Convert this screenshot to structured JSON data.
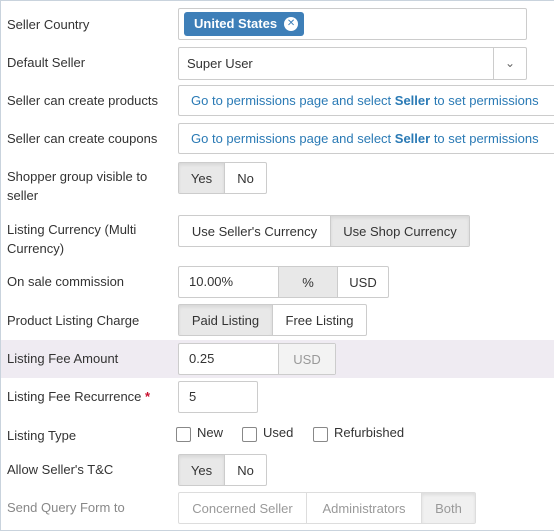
{
  "fields": {
    "seller_country": {
      "label": "Seller Country",
      "chip": "United States",
      "chip_icon": "close-circle-icon"
    },
    "default_seller": {
      "label": "Default Seller",
      "value": "Super User",
      "arrow_icon": "chevron-down-icon"
    },
    "can_create_products": {
      "label": "Seller can create products",
      "link_pre": "Go to permissions page and select ",
      "link_bold": "Seller",
      "link_post": " to set permissions"
    },
    "can_create_coupons": {
      "label": "Seller can create coupons",
      "link_pre": "Go to permissions page and select ",
      "link_bold": "Seller",
      "link_post": " to set permissions"
    },
    "shopper_group_visible": {
      "label": "Shopper group visible to seller",
      "options": [
        "Yes",
        "No"
      ],
      "selected": "Yes"
    },
    "listing_currency": {
      "label": "Listing Currency (Multi Currency)",
      "options": [
        "Use Seller's Currency",
        "Use Shop Currency"
      ],
      "selected": "Use Shop Currency"
    },
    "on_sale_commission": {
      "label": "On sale commission",
      "value": "10.00%",
      "options": [
        "%",
        "USD"
      ],
      "selected": "%"
    },
    "product_listing_charge": {
      "label": "Product Listing Charge",
      "options": [
        "Paid Listing",
        "Free Listing"
      ],
      "selected": "Paid Listing"
    },
    "listing_fee_amount": {
      "label": "Listing Fee Amount",
      "value": "0.25",
      "addon": "USD"
    },
    "listing_fee_recurrence": {
      "label": "Listing Fee Recurrence",
      "required_mark": "*",
      "value": "5"
    },
    "listing_type": {
      "label": "Listing Type",
      "options": [
        "New",
        "Used",
        "Refurbished"
      ],
      "checked": []
    },
    "allow_sellers_tc": {
      "label": "Allow Seller's T&C",
      "options": [
        "Yes",
        "No"
      ],
      "selected": "Yes"
    },
    "send_query_form_to": {
      "label": "Send Query Form to",
      "options": [
        "Concerned Seller",
        "Administrators",
        "Both"
      ],
      "selected": "Both"
    }
  },
  "colors": {
    "chip_bg": "#3e7fb8",
    "link": "#2a7ab5",
    "required": "#c8102e",
    "highlight_row": "#efebf2",
    "active_button": "#e8e8e8"
  }
}
